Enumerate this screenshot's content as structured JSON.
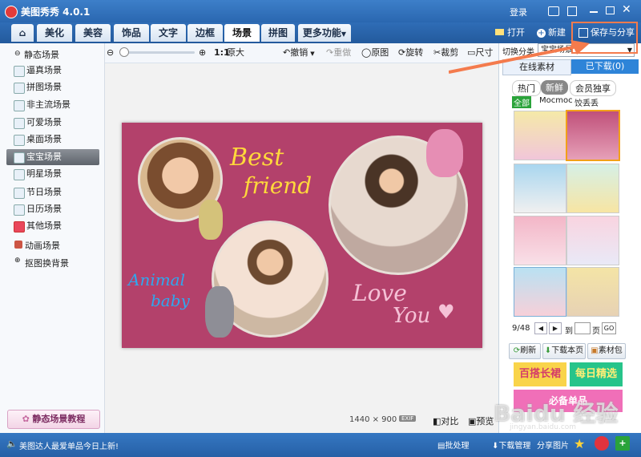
{
  "app": {
    "title": "美图秀秀 4.0.1"
  },
  "titlebar": {
    "login": "登录"
  },
  "tabs": [
    {
      "label": "美化"
    },
    {
      "label": "美容"
    },
    {
      "label": "饰品"
    },
    {
      "label": "文字"
    },
    {
      "label": "边框"
    },
    {
      "label": "场景"
    },
    {
      "label": "拼图"
    },
    {
      "label": "更多功能"
    }
  ],
  "top_actions": {
    "open": "打开",
    "new": "新建",
    "save_share": "保存与分享"
  },
  "toolbar": {
    "zoom_original_ratio": "1:1",
    "zoom_original": "原大",
    "undo": "撤销",
    "redo": "重做",
    "original": "原图",
    "rotate": "旋转",
    "crop": "裁剪",
    "size": "尺寸"
  },
  "sidebar": {
    "groups": [
      {
        "label": "静态场景"
      },
      {
        "label": "动画场景"
      },
      {
        "label": "抠图换背景"
      }
    ],
    "items": [
      {
        "label": "逼真场景"
      },
      {
        "label": "拼图场景"
      },
      {
        "label": "非主流场景"
      },
      {
        "label": "可爱场景"
      },
      {
        "label": "桌面场景"
      },
      {
        "label": "宝宝场景"
      },
      {
        "label": "明星场景"
      },
      {
        "label": "节日场景"
      },
      {
        "label": "日历场景"
      },
      {
        "label": "其他场景"
      }
    ],
    "tutorial": "静态场景教程"
  },
  "canvas": {
    "text_best": "Best",
    "text_friend": "friend",
    "text_animal": "Animal",
    "text_baby": "baby",
    "text_love": "Love",
    "text_you": "You",
    "dimensions": "1440 × 900",
    "compare": "对比",
    "preview": "预览"
  },
  "right_panel": {
    "switch_label": "切换分类",
    "category_value": "宝宝场景",
    "tab_online": "在线素材",
    "tab_downloaded": "已下载(0)",
    "subtabs": [
      "热门",
      "新鲜",
      "会员独享"
    ],
    "filters": [
      "全部",
      "Mocmoc",
      "饺丢丢"
    ],
    "page_indicator": "9/48",
    "page_goto": "到",
    "page_unit": "页",
    "go": "GO",
    "refresh": "刷新",
    "download_page": "下载本页",
    "material_pack": "素材包",
    "banner1": "百搭长裙",
    "banner2": "每日精选",
    "banner3": "必备单品"
  },
  "statusbar": {
    "message": "美图达人最爱单品今日上新!",
    "batch": "批处理",
    "download_manage": "下载管理",
    "share_image": "分享图片"
  },
  "watermark": {
    "site": "jingyan.baidu.com",
    "brand": "Baidu 经验"
  },
  "colors": {
    "accent": "#2a67b0",
    "highlight": "#f47b4d",
    "canvas_bg": "#b3416b"
  }
}
